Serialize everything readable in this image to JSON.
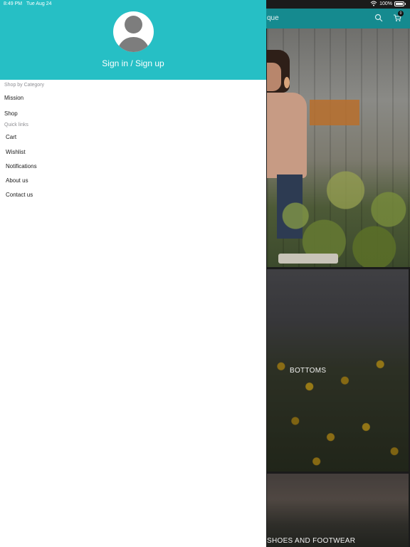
{
  "status_bar": {
    "time": "8:49 PM",
    "date": "Tue Aug 24",
    "battery": "100%"
  },
  "app": {
    "title_partial": "que",
    "cart_count": "0",
    "categories": [
      {
        "label": "BOTTOMS"
      },
      {
        "label": "SHOES AND FOOTWEAR"
      }
    ]
  },
  "drawer": {
    "signin_label": "Sign in / Sign up",
    "sections": {
      "shop_by_category": "Shop by Category",
      "quick_links": "Quick links"
    },
    "category_items": [
      "Mission",
      "Shop"
    ],
    "quick_link_items": [
      "Cart",
      "Wishlist",
      "Notifications",
      "About us",
      "Contact us"
    ]
  },
  "colors": {
    "drawer_header": "#26bfc5",
    "app_header": "#158a8f",
    "avatar_gray": "#7d7d7d"
  },
  "icons": {
    "wifi": "wifi-icon",
    "battery": "battery-icon",
    "search": "search-icon",
    "cart": "cart-icon",
    "avatar": "user-avatar-icon"
  }
}
